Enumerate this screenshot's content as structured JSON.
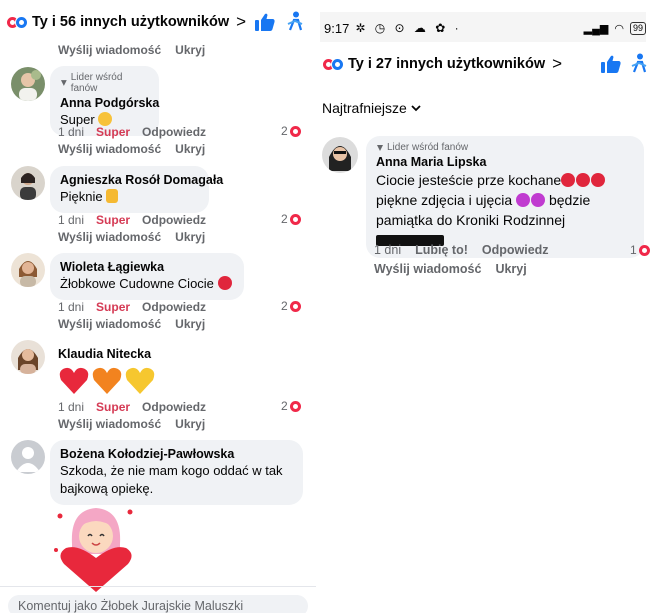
{
  "left": {
    "header": {
      "title": "Ty i 56 innych użytkowników",
      "chevron": ">"
    },
    "top_actions": {
      "reply": "Wyślij wiadomość",
      "hide": "Ukryj"
    },
    "comments": [
      {
        "fan_badge": "Lider wśród fanów",
        "name": "Anna Podgórska",
        "text": "Super",
        "time": "1 dni",
        "reaction": "Super",
        "reply": "Odpowiedz",
        "count": "2",
        "send": "Wyślij wiadomość",
        "hide": "Ukryj"
      },
      {
        "name": "Agnieszka Rosół Domagała",
        "text": "Pięknie",
        "time": "1 dni",
        "reaction": "Super",
        "reply": "Odpowiedz",
        "count": "2",
        "send": "Wyślij wiadomość",
        "hide": "Ukryj"
      },
      {
        "name": "Wioleta Łągiewka",
        "text": "Żłobkowe Cudowne Ciocie",
        "time": "1 dni",
        "reaction": "Super",
        "reply": "Odpowiedz",
        "count": "2",
        "send": "Wyślij wiadomość",
        "hide": "Ukryj"
      },
      {
        "name": "Klaudia Nitecka",
        "time": "1 dni",
        "reaction": "Super",
        "reply": "Odpowiedz",
        "count": "2",
        "send": "Wyślij wiadomość",
        "hide": "Ukryj"
      },
      {
        "name": "Bożena Kołodziej-Pawłowska",
        "text": "Szkoda, że nie mam kogo oddać w tak bajkową opiekę."
      }
    ],
    "comment_input": {
      "placeholder": "Komentuj jako Żłobek Jurajskie Maluszki"
    }
  },
  "right": {
    "status": {
      "time": "9:17",
      "battery": "99"
    },
    "header": {
      "title": "Ty i 27 innych użytkowników",
      "chevron": ">"
    },
    "sort_label": "Najtrafniejsze",
    "comment": {
      "fan_badge": "Lider wśród fanów",
      "name": "Anna Maria Lipska",
      "line1": "Ciocie jesteście prze kochane",
      "line2a": "piękne zdjęcia i ujęcia",
      "line2b": "będzie",
      "line3": "pamiątka do Kroniki Rodzinnej",
      "time": "1 dni",
      "like": "Lubię to!",
      "reply": "Odpowiedz",
      "count": "1",
      "send": "Wyślij wiadomość",
      "hide": "Ukryj"
    }
  },
  "colors": {
    "love_red": "#f02849",
    "like_blue": "#1877f2",
    "super_label": "#d53b55",
    "bubble_bg": "#f0f2f5",
    "muted_text": "#65676b"
  },
  "icons": [
    "love-reaction-icon",
    "like-reaction-icon",
    "thumbs-up-icon",
    "share-figure-icon",
    "chevron-right-icon",
    "chevron-down-icon",
    "shield-badge-icon"
  ]
}
